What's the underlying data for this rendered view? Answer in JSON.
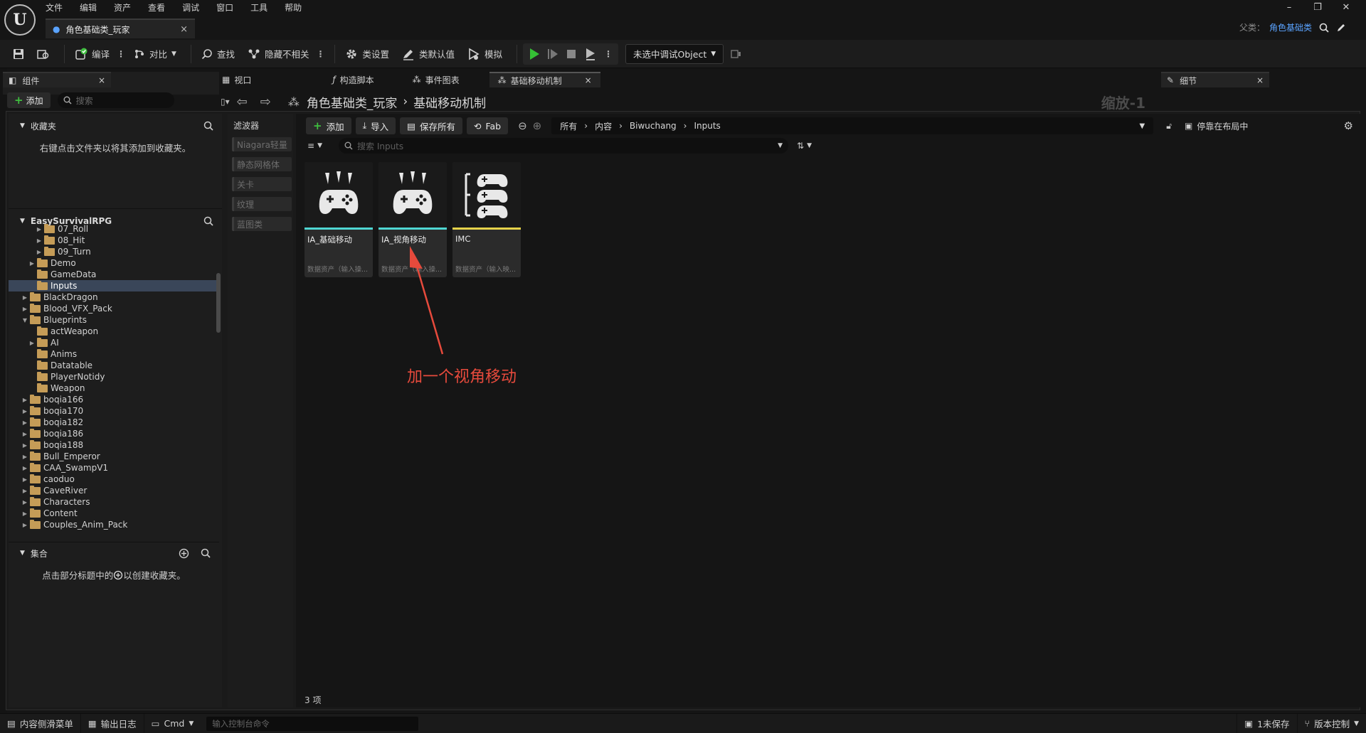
{
  "menu": [
    "文件",
    "编辑",
    "资产",
    "查看",
    "调试",
    "窗口",
    "工具",
    "帮助"
  ],
  "logo_text": "U",
  "doc_tab": {
    "title": "角色基础类_玩家",
    "close": "×"
  },
  "window_controls": {
    "minimize": "–",
    "restore": "❐",
    "close": "✕"
  },
  "parent_class": {
    "label": "父类：",
    "value": "角色基础类"
  },
  "toolbar": {
    "compile": "编译",
    "diff": "对比",
    "find": "查找",
    "hide_unrelated": "隐藏不相关",
    "class_settings": "类设置",
    "class_defaults": "类默认值",
    "simulate": "模拟",
    "debug_object": "未选中调试Object"
  },
  "components_panel": {
    "tab": "组件",
    "add": "添加",
    "search_placeholder": "搜索"
  },
  "details_panel": {
    "tab": "细节"
  },
  "editor_tabs": [
    "视口",
    "构造脚本",
    "事件图表",
    "基础移动机制"
  ],
  "graph_breadcrumb": {
    "root": "角色基础类_玩家",
    "sep": "›",
    "graph": "基础移动机制",
    "zoom": "缩放-1"
  },
  "favorites": {
    "title": "收藏夹",
    "hint": "右键点击文件夹以将其添加到收藏夹。"
  },
  "project": {
    "title": "EasySurvivalRPG"
  },
  "tree": [
    {
      "label": "07_Roll",
      "indent": 3,
      "arrow": "▶"
    },
    {
      "label": "08_Hit",
      "indent": 3,
      "arrow": "▶"
    },
    {
      "label": "09_Turn",
      "indent": 3,
      "arrow": "▶"
    },
    {
      "label": "Demo",
      "indent": 2,
      "arrow": "▶"
    },
    {
      "label": "GameData",
      "indent": 2,
      "arrow": ""
    },
    {
      "label": "Inputs",
      "indent": 2,
      "arrow": "",
      "selected": true
    },
    {
      "label": "BlackDragon",
      "indent": 1,
      "arrow": "▶"
    },
    {
      "label": "Blood_VFX_Pack",
      "indent": 1,
      "arrow": "▶"
    },
    {
      "label": "Blueprints",
      "indent": 1,
      "arrow": "▼"
    },
    {
      "label": "actWeapon",
      "indent": 2,
      "arrow": ""
    },
    {
      "label": "AI",
      "indent": 2,
      "arrow": "▶"
    },
    {
      "label": "Anims",
      "indent": 2,
      "arrow": ""
    },
    {
      "label": "Datatable",
      "indent": 2,
      "arrow": ""
    },
    {
      "label": "PlayerNotidy",
      "indent": 2,
      "arrow": ""
    },
    {
      "label": "Weapon",
      "indent": 2,
      "arrow": ""
    },
    {
      "label": "boqia166",
      "indent": 1,
      "arrow": "▶"
    },
    {
      "label": "boqia170",
      "indent": 1,
      "arrow": "▶"
    },
    {
      "label": "boqia182",
      "indent": 1,
      "arrow": "▶"
    },
    {
      "label": "boqia186",
      "indent": 1,
      "arrow": "▶"
    },
    {
      "label": "boqia188",
      "indent": 1,
      "arrow": "▶"
    },
    {
      "label": "Bull_Emperor",
      "indent": 1,
      "arrow": "▶"
    },
    {
      "label": "CAA_SwampV1",
      "indent": 1,
      "arrow": "▶"
    },
    {
      "label": "caoduo",
      "indent": 1,
      "arrow": "▶"
    },
    {
      "label": "CaveRiver",
      "indent": 1,
      "arrow": "▶"
    },
    {
      "label": "Characters",
      "indent": 1,
      "arrow": "▶"
    },
    {
      "label": "Content",
      "indent": 1,
      "arrow": "▶"
    },
    {
      "label": "Couples_Anim_Pack",
      "indent": 1,
      "arrow": "▶"
    }
  ],
  "collections": {
    "title": "集合",
    "hint_before": "点击部分标题中的",
    "hint_after": "以创建收藏夹。"
  },
  "filters": {
    "title": "滤波器",
    "items": [
      "Niagara轻量",
      "静态网格体",
      "关卡",
      "纹理",
      "蓝图类"
    ]
  },
  "content_toolbar": {
    "add": "添加",
    "import": "导入",
    "save_all": "保存所有",
    "fab": "Fab",
    "path": [
      "所有",
      "内容",
      "Biwuchang",
      "Inputs"
    ],
    "dock": "停靠在布局中",
    "search_placeholder": "搜索 Inputs"
  },
  "assets": [
    {
      "name": "IA_基础移动",
      "type": "数据资产（输入操...",
      "accent": "#4fd6d2",
      "icon": "gamepad-action-icon"
    },
    {
      "name": "IA_视角移动",
      "type": "数据资产（输入操...",
      "accent": "#4fd6d2",
      "icon": "gamepad-action-icon"
    },
    {
      "name": "IMC",
      "type": "数据资产（输入映...",
      "accent": "#e6d34a",
      "icon": "gamepad-mapping-icon"
    }
  ],
  "annotation": "加一个视角移动",
  "item_count": "3 项",
  "statusbar": {
    "content_drawer": "内容侧滑菜单",
    "output_log": "输出日志",
    "cmd": "Cmd",
    "console_placeholder": "输入控制台命令",
    "unsaved": "1未保存",
    "source_control": "版本控制"
  },
  "colors": {
    "accent_blue": "#5aa3ff",
    "annotation_red": "#e64a3c",
    "selection": "#3a4659"
  }
}
